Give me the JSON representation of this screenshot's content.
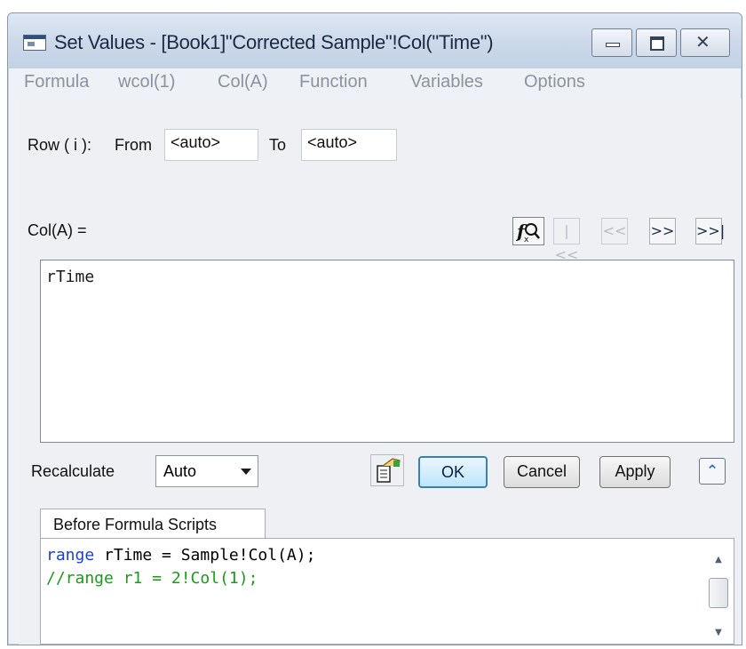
{
  "window": {
    "title": "Set Values - [Book1]\"Corrected Sample\"!Col(\"Time\")",
    "close_glyph": "✕"
  },
  "menu": [
    "Formula",
    "wcol(1)",
    "Col(A)",
    "Function",
    "Variables",
    "Options"
  ],
  "row_range": {
    "label": "Row ( i ):",
    "from_label": "From",
    "from_value": "<auto>",
    "to_label": "To",
    "to_value": "<auto>"
  },
  "formula": {
    "label": "Col(A) =",
    "text": "rTime",
    "nav": [
      "|<<",
      "<<",
      ">>",
      ">>|"
    ]
  },
  "recalculate": {
    "label": "Recalculate",
    "value": "Auto"
  },
  "buttons": {
    "ok": "OK",
    "cancel": "Cancel",
    "apply": "Apply",
    "collapse": "⌃"
  },
  "scripts": {
    "tab_label": "Before Formula Scripts",
    "line1_kw": "range",
    "line1_rest": " rTime = Sample!Col(A);",
    "line2": "//range r1 = 2!Col(1);"
  },
  "icons": {
    "app": "window-icon",
    "fx": "function-browser-icon",
    "load": "load-formula-icon"
  }
}
